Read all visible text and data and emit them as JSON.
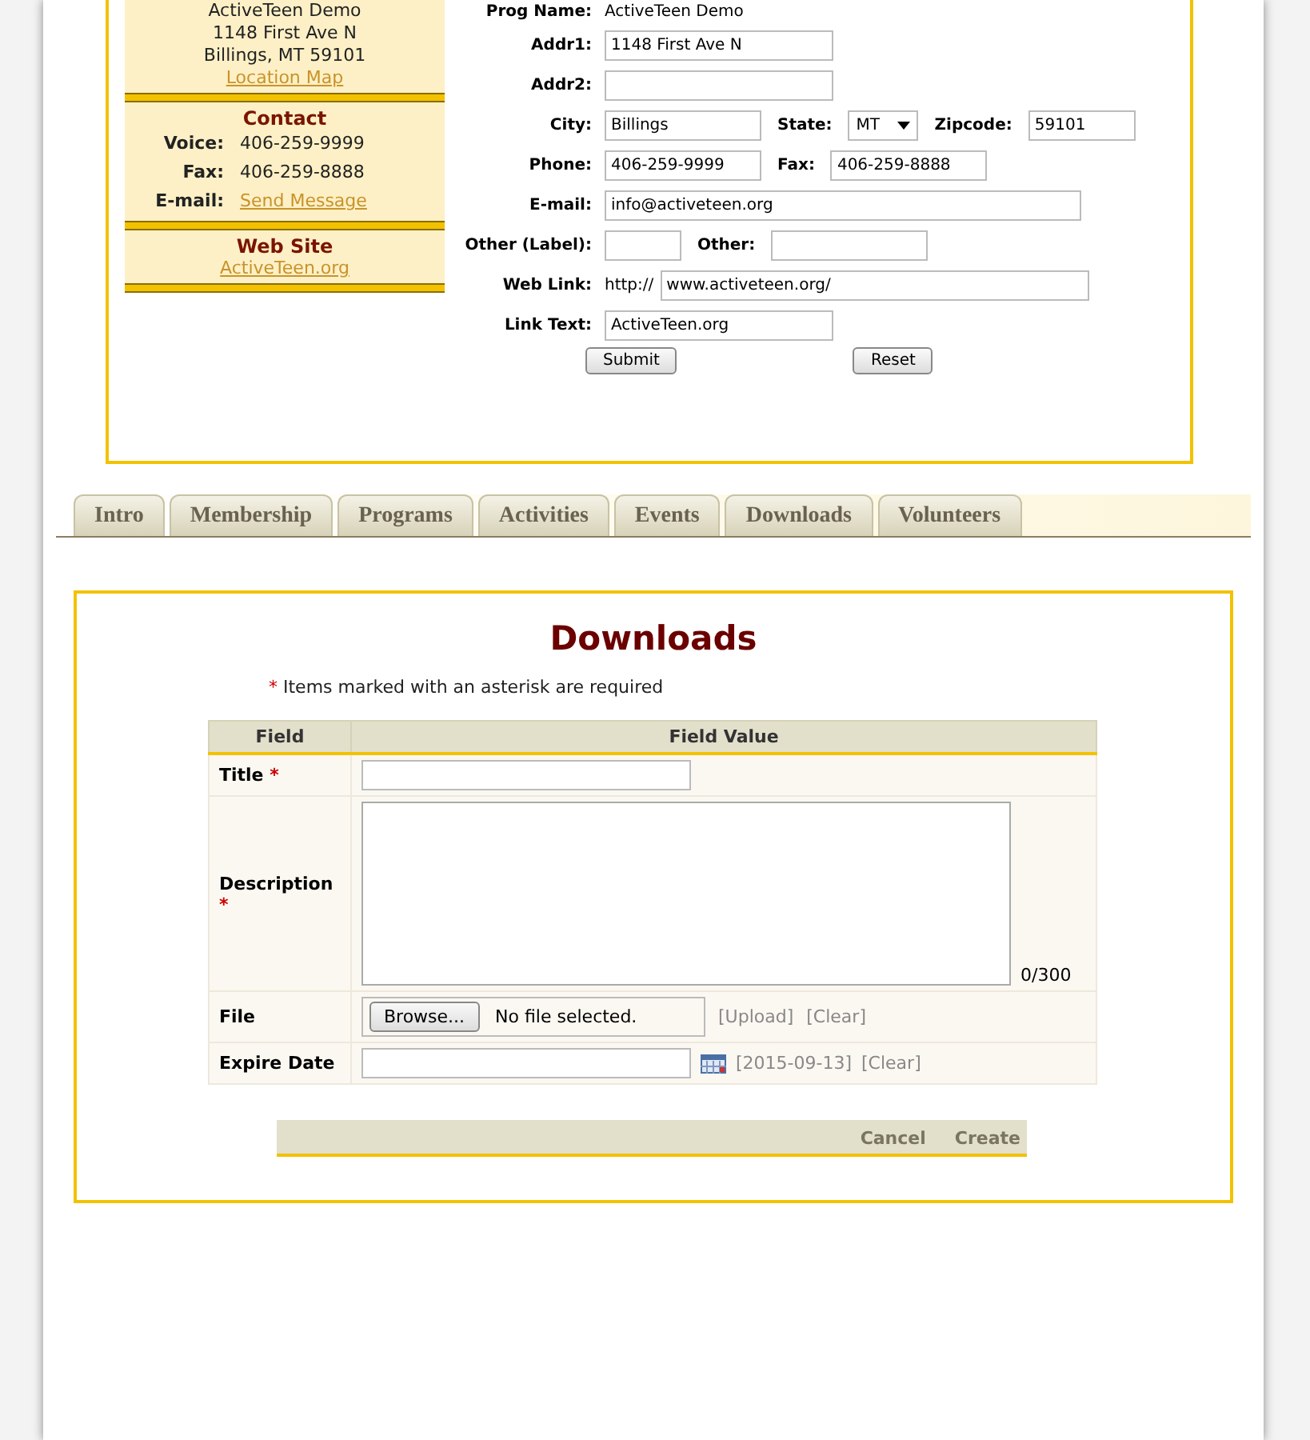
{
  "location": {
    "lines": [
      "ActiveTeen Demo",
      "1148 First Ave N",
      "Billings, MT 59101"
    ],
    "link": "Location Map"
  },
  "contact": {
    "title": "Contact",
    "rows": [
      {
        "label": "Voice:",
        "value": "406-259-9999",
        "kind": "text"
      },
      {
        "label": "Fax:",
        "value": "406-259-8888",
        "kind": "text"
      },
      {
        "label": "E-mail:",
        "value": "Send Message",
        "kind": "link"
      }
    ]
  },
  "website": {
    "title": "Web Site",
    "link": "ActiveTeen.org"
  },
  "program_form": {
    "prog_name": {
      "label": "Prog Name:",
      "value": "ActiveTeen Demo"
    },
    "addr1": {
      "label": "Addr1:",
      "value": "1148 First Ave N"
    },
    "addr2": {
      "label": "Addr2:"
    },
    "city": {
      "label": "City:",
      "value": "Billings"
    },
    "state": {
      "label": "State:",
      "value": "MT"
    },
    "zipcode": {
      "label": "Zipcode:",
      "value": "59101"
    },
    "phone": {
      "label": "Phone:",
      "value": "406-259-9999"
    },
    "fax": {
      "label": "Fax:",
      "value": "406-259-8888"
    },
    "email": {
      "label": "E-mail:",
      "value": "info@activeteen.org"
    },
    "other_label": {
      "label": "Other (Label):"
    },
    "other": {
      "label": "Other:"
    },
    "web_link": {
      "label": "Web Link:",
      "prefix": "http://",
      "value": "www.activeteen.org/"
    },
    "link_text": {
      "label": "Link Text:",
      "value": "ActiveTeen.org"
    },
    "buttons": [
      "Submit",
      "Reset"
    ]
  },
  "tabs": [
    "Intro",
    "Membership",
    "Programs",
    "Activities",
    "Events",
    "Downloads",
    "Volunteers"
  ],
  "downloads": {
    "title": "Downloads",
    "note_marker": "*",
    "required_note": "Items marked with an asterisk are required",
    "columns": [
      "Field",
      "Field Value"
    ],
    "rows": [
      {
        "label": "Title",
        "required_marker": "*",
        "kind": "text"
      },
      {
        "label": "Description",
        "required_marker": "*",
        "kind": "textarea",
        "counter": "0/300"
      },
      {
        "label": "File",
        "kind": "file",
        "button": "Browse...",
        "status": "No file selected.",
        "links": [
          "[Upload]",
          "[Clear]"
        ]
      },
      {
        "label": "Expire Date",
        "kind": "date",
        "links": [
          "[2015-09-13]",
          "[Clear]"
        ]
      }
    ],
    "actions": [
      "Cancel",
      "Create"
    ]
  }
}
